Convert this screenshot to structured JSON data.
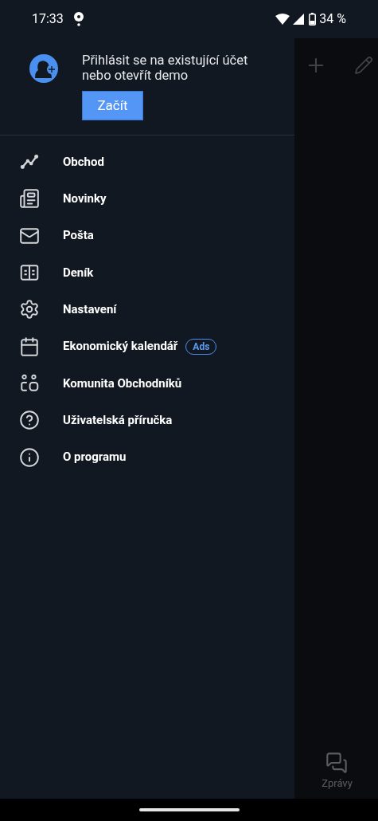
{
  "status_bar": {
    "time": "17:33",
    "battery": "34 %"
  },
  "account": {
    "prompt": "Přihlásit se na existující účet nebo otevřít demo",
    "button": "Začít"
  },
  "menu": [
    {
      "label": "Obchod"
    },
    {
      "label": "Novinky"
    },
    {
      "label": "Pošta"
    },
    {
      "label": "Deník"
    },
    {
      "label": "Nastavení"
    },
    {
      "label": "Ekonomický kalendář",
      "badge": "Ads"
    },
    {
      "label": "Komunita Obchodníků"
    },
    {
      "label": "Uživatelská příručka"
    },
    {
      "label": "O programu"
    }
  ],
  "background_tab": {
    "label": "Zprávy"
  }
}
